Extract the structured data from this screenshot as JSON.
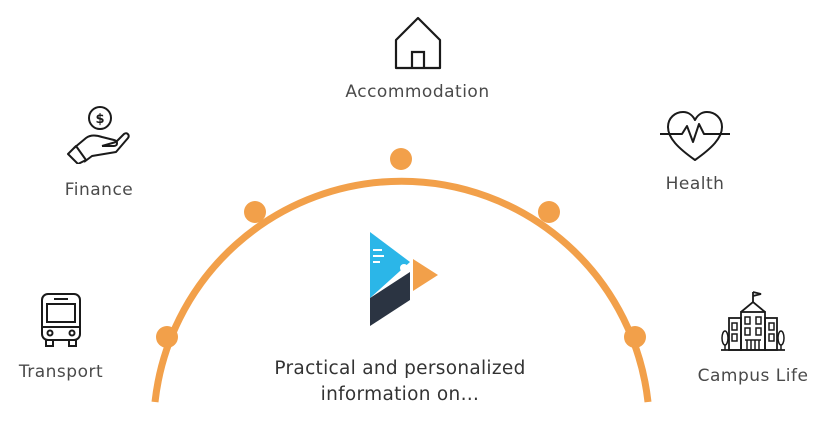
{
  "colors": {
    "accent": "#f2a04a",
    "logo_blue": "#2bb6e8",
    "logo_dark": "#2b3442",
    "icon_stroke": "#1a1a1a",
    "text": "#4a4a4a"
  },
  "center": {
    "logo_icon": "brand-logo-icon",
    "line1": "Practical and personalized",
    "line2": "information on…"
  },
  "topics": [
    {
      "id": "accommodation",
      "label": "Accommodation",
      "icon": "house-icon"
    },
    {
      "id": "finance",
      "label": "Finance",
      "icon": "hand-coin-icon"
    },
    {
      "id": "health",
      "label": "Health",
      "icon": "heart-pulse-icon"
    },
    {
      "id": "transport",
      "label": "Transport",
      "icon": "bus-icon"
    },
    {
      "id": "campus",
      "label": "Campus Life",
      "icon": "campus-building-icon"
    }
  ]
}
